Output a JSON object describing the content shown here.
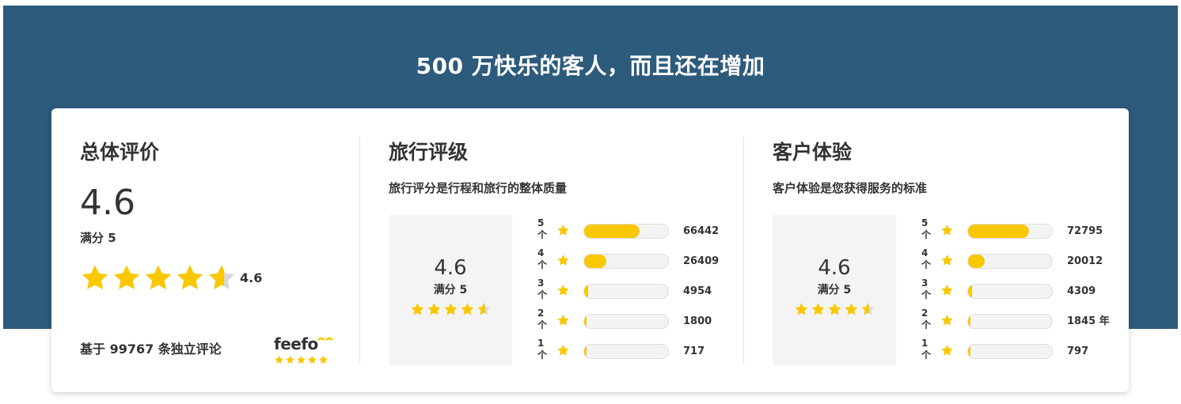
{
  "colors": {
    "banner": "#2d5b7c",
    "star": "#f9c800",
    "star_empty": "#d9d9d9",
    "bar_track": "#f3f3f3"
  },
  "headline": "500 万快乐的客人，而且还在增加",
  "overall": {
    "title": "总体评价",
    "score": "4.6",
    "out_of": "满分 5",
    "rating": 4.6,
    "stars_label": "4.6",
    "based_on": "基于 99767 条独立评论",
    "feefo_brand": "feefo"
  },
  "sections": [
    {
      "title": "旅行评级",
      "subtitle": "旅行评分是行程和旅行的整体质量",
      "score": "4.6",
      "out_of": "满分 5",
      "rating": 4.6,
      "rows": [
        {
          "label": "5 个",
          "fraction": 0.66,
          "count": "66442"
        },
        {
          "label": "4 个",
          "fraction": 0.26,
          "count": "26409"
        },
        {
          "label": "3 个",
          "fraction": 0.05,
          "count": "4954"
        },
        {
          "label": "2 个",
          "fraction": 0.018,
          "count": "1800"
        },
        {
          "label": "1 个",
          "fraction": 0.007,
          "count": "717"
        }
      ]
    },
    {
      "title": "客户体验",
      "subtitle": "客户体验是您获得服务的标准",
      "score": "4.6",
      "out_of": "满分 5",
      "rating": 4.6,
      "rows": [
        {
          "label": "5 个",
          "fraction": 0.73,
          "count": "72795"
        },
        {
          "label": "4 个",
          "fraction": 0.2,
          "count": "20012"
        },
        {
          "label": "3 个",
          "fraction": 0.043,
          "count": "4309"
        },
        {
          "label": "2 个",
          "fraction": 0.018,
          "count": "1845 年"
        },
        {
          "label": "1 个",
          "fraction": 0.008,
          "count": "797"
        }
      ]
    }
  ]
}
